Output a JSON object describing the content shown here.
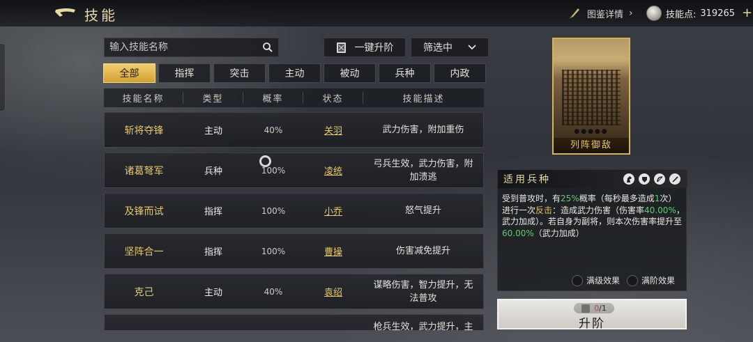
{
  "header": {
    "title": "技能",
    "codex_label": "图鉴详情",
    "skill_points_label": "技能点:",
    "skill_points_value": "319265"
  },
  "search": {
    "placeholder": "输入技能名称"
  },
  "toolbar": {
    "upgrade_all_label": "一键升阶",
    "filter_label": "筛选中"
  },
  "tabs": [
    {
      "label": "全部",
      "active": true
    },
    {
      "label": "指挥"
    },
    {
      "label": "突击"
    },
    {
      "label": "主动"
    },
    {
      "label": "被动"
    },
    {
      "label": "兵种"
    },
    {
      "label": "内政"
    }
  ],
  "table": {
    "headers": [
      "技能名称",
      "类型",
      "概率",
      "状态",
      "技能描述"
    ],
    "rows": [
      {
        "name": "斩将夺锋",
        "type": "主动",
        "rate": "40%",
        "status": "关羽",
        "desc": "武力伤害，附加重伤"
      },
      {
        "name": "诸葛弩军",
        "type": "兵种",
        "rate": "100%",
        "status": "凌统",
        "desc": "弓兵生效，武力伤害，附加溃逃"
      },
      {
        "name": "及锋而试",
        "type": "指挥",
        "rate": "100%",
        "status": "小乔",
        "desc": "怒气提升"
      },
      {
        "name": "坚阵合一",
        "type": "指挥",
        "rate": "100%",
        "status": "曹操",
        "desc": "伤害减免提升"
      },
      {
        "name": "克己",
        "type": "主动",
        "rate": "40%",
        "status": "袁绍",
        "desc": "谋略伤害，智力提升，无法普攻"
      },
      {
        "name": "",
        "type": "",
        "rate": "",
        "status": "",
        "desc": "枪兵生效，武力提升，主动"
      }
    ]
  },
  "card": {
    "title": "列阵御敌",
    "stars": "●●●●●"
  },
  "detail": {
    "title": "适用兵种",
    "text_parts": [
      {
        "t": "受到普攻时，有"
      },
      {
        "t": "25%",
        "c": "green"
      },
      {
        "t": "概率（每秒最多造成"
      },
      {
        "t": "1",
        "c": "green"
      },
      {
        "t": "次）进行一次"
      },
      {
        "t": "反击",
        "c": "gold"
      },
      {
        "t": "：造成武力伤害（伤害率"
      },
      {
        "t": "40.00%",
        "c": "green"
      },
      {
        "t": "，武力加成）。若自身为副将，则本次伤害率提升至"
      },
      {
        "t": "60.00%",
        "c": "green"
      },
      {
        "t": "（武力加成）"
      }
    ],
    "toggle_max_level": "满级效果",
    "toggle_max_rank": "满阶效果"
  },
  "advance": {
    "label": "升阶",
    "cost_have": "0",
    "cost_need": "/1"
  },
  "colors": {
    "accent_gold": "#e8c867",
    "highlight_green": "#58d06b",
    "cost_red": "#d8352c"
  }
}
